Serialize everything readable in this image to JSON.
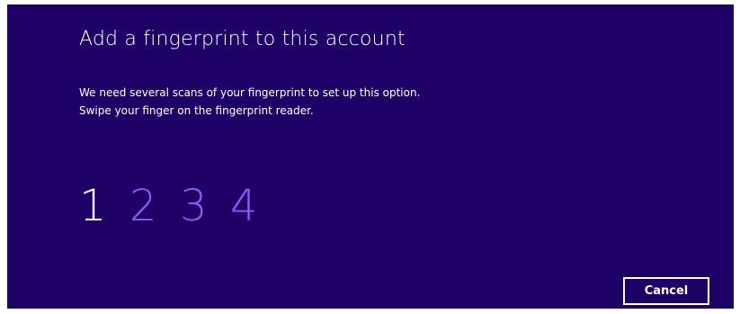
{
  "dialog": {
    "title": "Add a fingerprint to this account",
    "description_line1": "We need several scans of your fingerprint to set up this option.",
    "description_line2": "Swipe your finger on the fingerprint reader.",
    "steps": [
      "1",
      "2",
      "3",
      "4"
    ],
    "active_step": 1,
    "cancel_label": "Cancel"
  },
  "colors": {
    "background": "#1f0066",
    "active_step": "#ffffff",
    "inactive_step": "#8a5cf5"
  }
}
